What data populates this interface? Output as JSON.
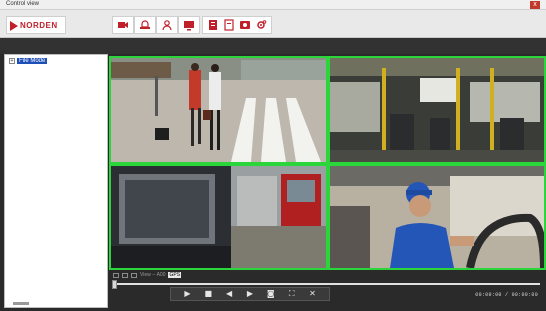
{
  "window": {
    "title": "Control view",
    "close_label": "x"
  },
  "toolbar": {
    "logo_text": "NORDEN",
    "groups": [
      {
        "icons": [
          "camera-icon"
        ]
      },
      {
        "icons": [
          "alarm-icon"
        ]
      },
      {
        "icons": [
          "user-icon"
        ]
      },
      {
        "icons": [
          "monitor-icon"
        ]
      },
      {
        "icons": [
          "report-icon",
          "document-icon",
          "record-icon",
          "settings-icon"
        ]
      }
    ]
  },
  "sidebar": {
    "tree": [
      {
        "label": "File Mode",
        "expanded": false,
        "selected": true
      }
    ]
  },
  "video_grid": {
    "layout": "2x2",
    "border_color": "#2bd63b",
    "tiles": [
      {
        "scene": "street-crosswalk"
      },
      {
        "scene": "bus-interior"
      },
      {
        "scene": "truck-mirror"
      },
      {
        "scene": "driver-cab"
      }
    ]
  },
  "controls": {
    "strip_text": "View -- A00",
    "badge": "GPS",
    "playback_buttons": [
      "play-icon",
      "stop-icon",
      "rewind-icon",
      "fast-forward-icon",
      "snapshot-icon",
      "fullscreen-icon",
      "close-icon"
    ],
    "timecode": "00:00:00 / 00:00:00"
  },
  "colors": {
    "accent": "#c0202a",
    "selection": "#1e4fb8",
    "tile_border": "#2bd63b"
  }
}
